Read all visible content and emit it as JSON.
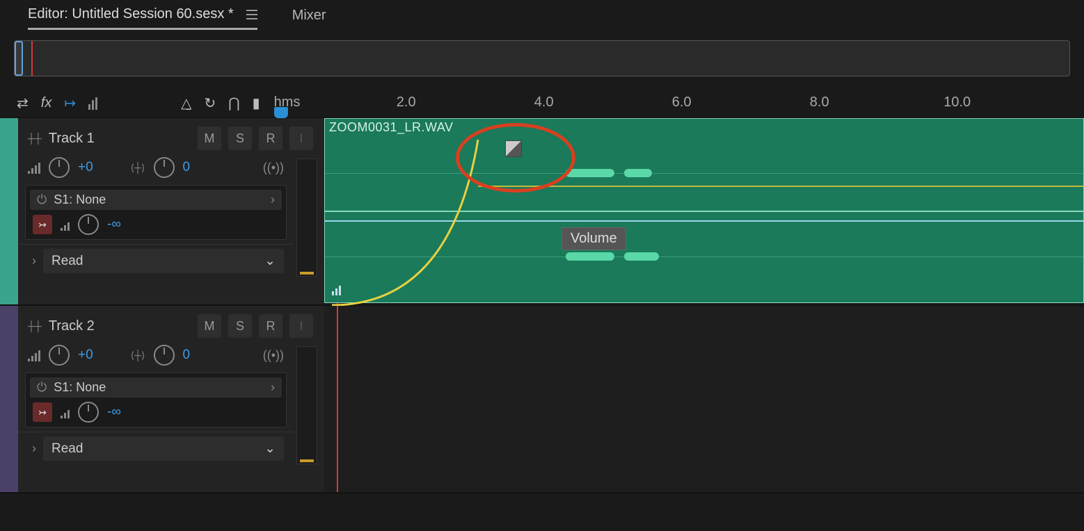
{
  "tabs": {
    "editor_label": "Editor: Untitled Session 60.sesx *",
    "mixer_label": "Mixer"
  },
  "timeline": {
    "unit": "hms",
    "ticks": [
      "2.0",
      "4.0",
      "6.0",
      "8.0",
      "10.0"
    ]
  },
  "clip": {
    "name": "ZOOM0031_LR.WAV",
    "tooltip": "Volume"
  },
  "tracks": [
    {
      "name": "Track 1",
      "color": "#3aa58a",
      "volume": "+0",
      "pan": "0",
      "send": "S1: None",
      "send_level": "-∞",
      "automation": "Read"
    },
    {
      "name": "Track 2",
      "color": "#4a4068",
      "volume": "+0",
      "pan": "0",
      "send": "S1: None",
      "send_level": "-∞",
      "automation": "Read"
    }
  ],
  "buttons": {
    "m": "M",
    "s": "S",
    "r": "R",
    "i": "I"
  }
}
